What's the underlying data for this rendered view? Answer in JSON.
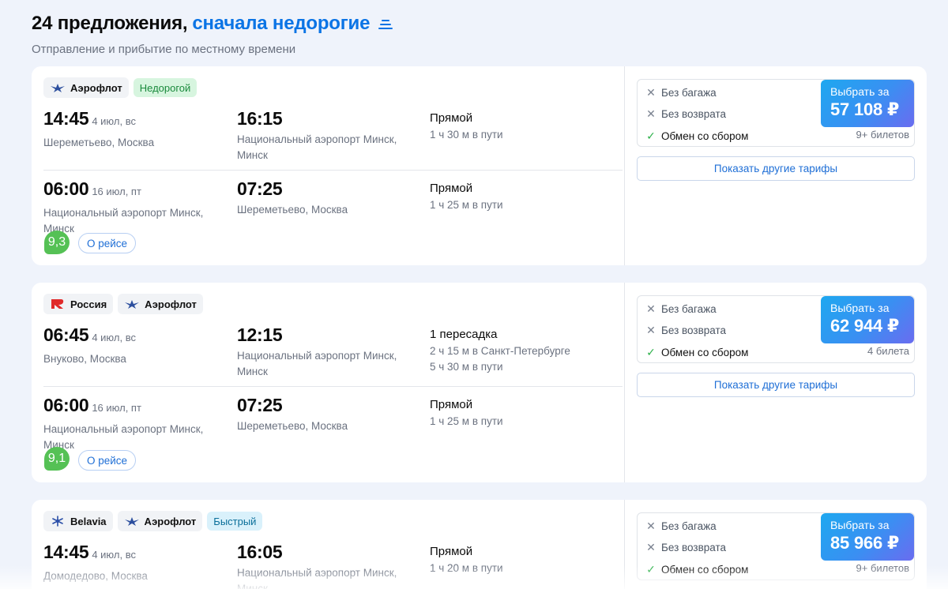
{
  "header": {
    "count_text": "24 предложения,",
    "sort_text": "сначала недорогие",
    "subtitle": "Отправление и прибытие по местному времени"
  },
  "offers": [
    {
      "carriers": [
        {
          "name": "Аэрофлот",
          "logo": "aeroflot-logo"
        }
      ],
      "badge": {
        "text": "Недорогой",
        "color": "#d7f5df"
      },
      "legs": [
        {
          "dep_time": "14:45",
          "dep_date": "4 июл, вс",
          "dep_place": "Шереметьево, Москва",
          "arr_time": "16:15",
          "arr_place": "Национальный аэропорт Минск, Минск",
          "route": "Прямой",
          "details": [
            "1 ч 30 м в пути"
          ]
        },
        {
          "dep_time": "06:00",
          "dep_date": "16 июл, пт",
          "dep_place": "Национальный аэропорт Минск, Минск",
          "arr_time": "07:25",
          "arr_place": "Шереметьево, Москва",
          "route": "Прямой",
          "details": [
            "1 ч 25 м в пути"
          ]
        }
      ],
      "rating": "9,3",
      "about_label": "О рейсе",
      "tariff": {
        "no_baggage": "Без багажа",
        "no_refund": "Без возврата",
        "exchange": "Обмен со сбором"
      },
      "buy_label": "Выбрать за",
      "price": "57 108 ₽",
      "tickets": "9+ билетов",
      "more_tariffs": "Показать другие тарифы"
    },
    {
      "carriers": [
        {
          "name": "Россия",
          "logo": "rossiya-logo"
        },
        {
          "name": "Аэрофлот",
          "logo": "aeroflot-logo"
        }
      ],
      "badge": null,
      "legs": [
        {
          "dep_time": "06:45",
          "dep_date": "4 июл, вс",
          "dep_place": "Внуково, Москва",
          "arr_time": "12:15",
          "arr_place": "Национальный аэропорт Минск, Минск",
          "route": "1 пересадка",
          "details": [
            "2 ч 15 м в Санкт-Петербурге",
            "5 ч 30 м в пути"
          ]
        },
        {
          "dep_time": "06:00",
          "dep_date": "16 июл, пт",
          "dep_place": "Национальный аэропорт Минск, Минск",
          "arr_time": "07:25",
          "arr_place": "Шереметьево, Москва",
          "route": "Прямой",
          "details": [
            "1 ч 25 м в пути"
          ]
        }
      ],
      "rating": "9,1",
      "about_label": "О рейсе",
      "tariff": {
        "no_baggage": "Без багажа",
        "no_refund": "Без возврата",
        "exchange": "Обмен со сбором"
      },
      "buy_label": "Выбрать за",
      "price": "62 944 ₽",
      "tickets": "4 билета",
      "more_tariffs": "Показать другие тарифы"
    },
    {
      "carriers": [
        {
          "name": "Belavia",
          "logo": "belavia-logo"
        },
        {
          "name": "Аэрофлот",
          "logo": "aeroflot-logo"
        }
      ],
      "badge": {
        "text": "Быстрый",
        "color": "#d9f1fb"
      },
      "legs": [
        {
          "dep_time": "14:45",
          "dep_date": "4 июл, вс",
          "dep_place": "Домодедово, Москва",
          "arr_time": "16:05",
          "arr_place": "Национальный аэропорт Минск, Минск",
          "route": "Прямой",
          "details": [
            "1 ч 20 м в пути"
          ]
        }
      ],
      "tariff": {
        "no_baggage": "Без багажа",
        "no_refund": "Без возврата",
        "exchange": "Обмен со сбором"
      },
      "buy_label": "Выбрать за",
      "price": "85 966 ₽",
      "tickets": "9+ билетов"
    }
  ],
  "colors": {
    "accent": "#0b74e5",
    "rating_green": "#55c155",
    "price_gradient_start": "#1ea8f0",
    "price_gradient_end": "#6a6cf0"
  }
}
